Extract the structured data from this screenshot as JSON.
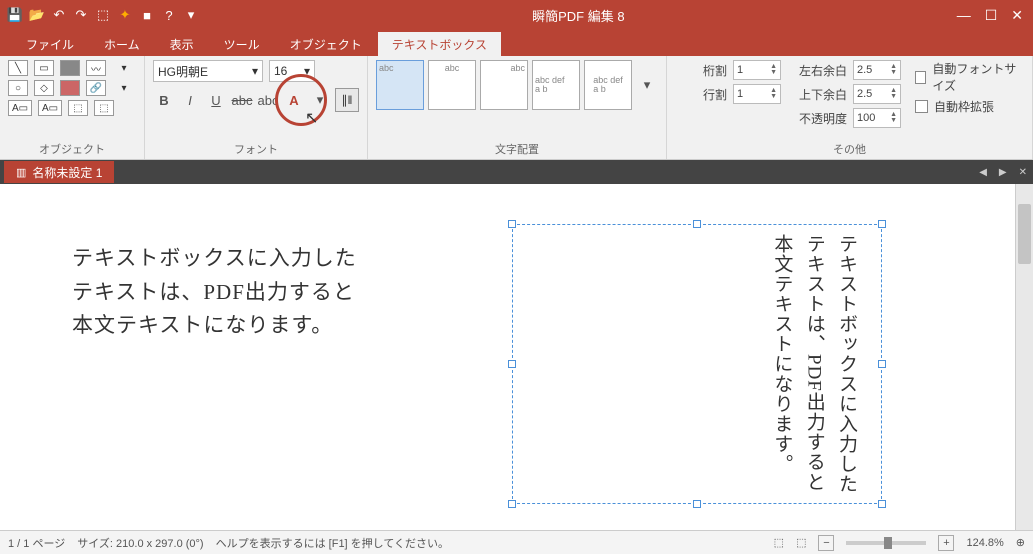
{
  "app_title": "瞬簡PDF 編集 8",
  "tabs": {
    "file": "ファイル",
    "home": "ホーム",
    "view": "表示",
    "tool": "ツール",
    "object": "オブジェクト",
    "textbox": "テキストボックス"
  },
  "ribbon": {
    "group_object": "オブジェクト",
    "group_font": "フォント",
    "group_align": "文字配置",
    "group_other": "その他",
    "font_name": "HG明朝E",
    "font_size": "16",
    "bold": "B",
    "italic": "I",
    "underline": "U",
    "strike": "abc",
    "caps": "abc",
    "color": "A",
    "vertical": "↕",
    "abox_txt": "abc",
    "abox_multi": "abc def\na b",
    "col_label": "桁割",
    "row_label": "行割",
    "col_val": "1",
    "row_val": "1",
    "lr_label": "左右余白",
    "lr_val": "2.5",
    "tb_label": "上下余白",
    "tb_val": "2.5",
    "opac_label": "不透明度",
    "opac_val": "100",
    "chk_autofont": "自動フォントサイズ",
    "chk_autofit": "自動枠拡張"
  },
  "doctab": "名称未設定 1",
  "body_text": "テキストボックスに入力した\nテキストは、PDF出力すると\n本文テキストになります。",
  "vert_text": "テキストボックスに入力したテキストは、PDF出力すると本文テキストになります。",
  "status": {
    "page": "1 / 1 ページ",
    "size": "サイズ: 210.0 x 297.0 (0°)",
    "help": "ヘルプを表示するには [F1] を押してください。",
    "zoom": "124.8%"
  }
}
